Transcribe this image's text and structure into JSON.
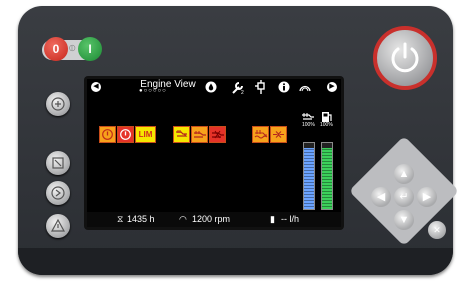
{
  "screen": {
    "title": "Engine View",
    "page_dots": "●○○○○○",
    "nav_left": "◀",
    "nav_right": "▶",
    "top_icons": [
      "fuel-drop-icon",
      "wrench-icon",
      "sensor-icon",
      "info-icon",
      "limiter-icon"
    ],
    "lim_label": "LIM",
    "gauge_labels": [
      "100%",
      "100%"
    ],
    "gauges": [
      {
        "name": "coolant",
        "level": 0.92,
        "color": "#6aa3ff"
      },
      {
        "name": "fuel",
        "level": 0.92,
        "color": "#3bd05a"
      }
    ],
    "hours": "1435 h",
    "rpm": "1200 rpm",
    "fuel_rate": "-- l/h"
  },
  "keys": {
    "tog_off": "0",
    "tog_mid": "⦶",
    "tog_on": "I",
    "enter": "↵",
    "close": "✕",
    "up": "▲",
    "down": "▼",
    "left": "◀",
    "right": "▶"
  },
  "colors": {
    "accent_red": "#c9302c",
    "amber": "#f7a21b",
    "red": "#e53228",
    "yellow": "#f6e600"
  }
}
